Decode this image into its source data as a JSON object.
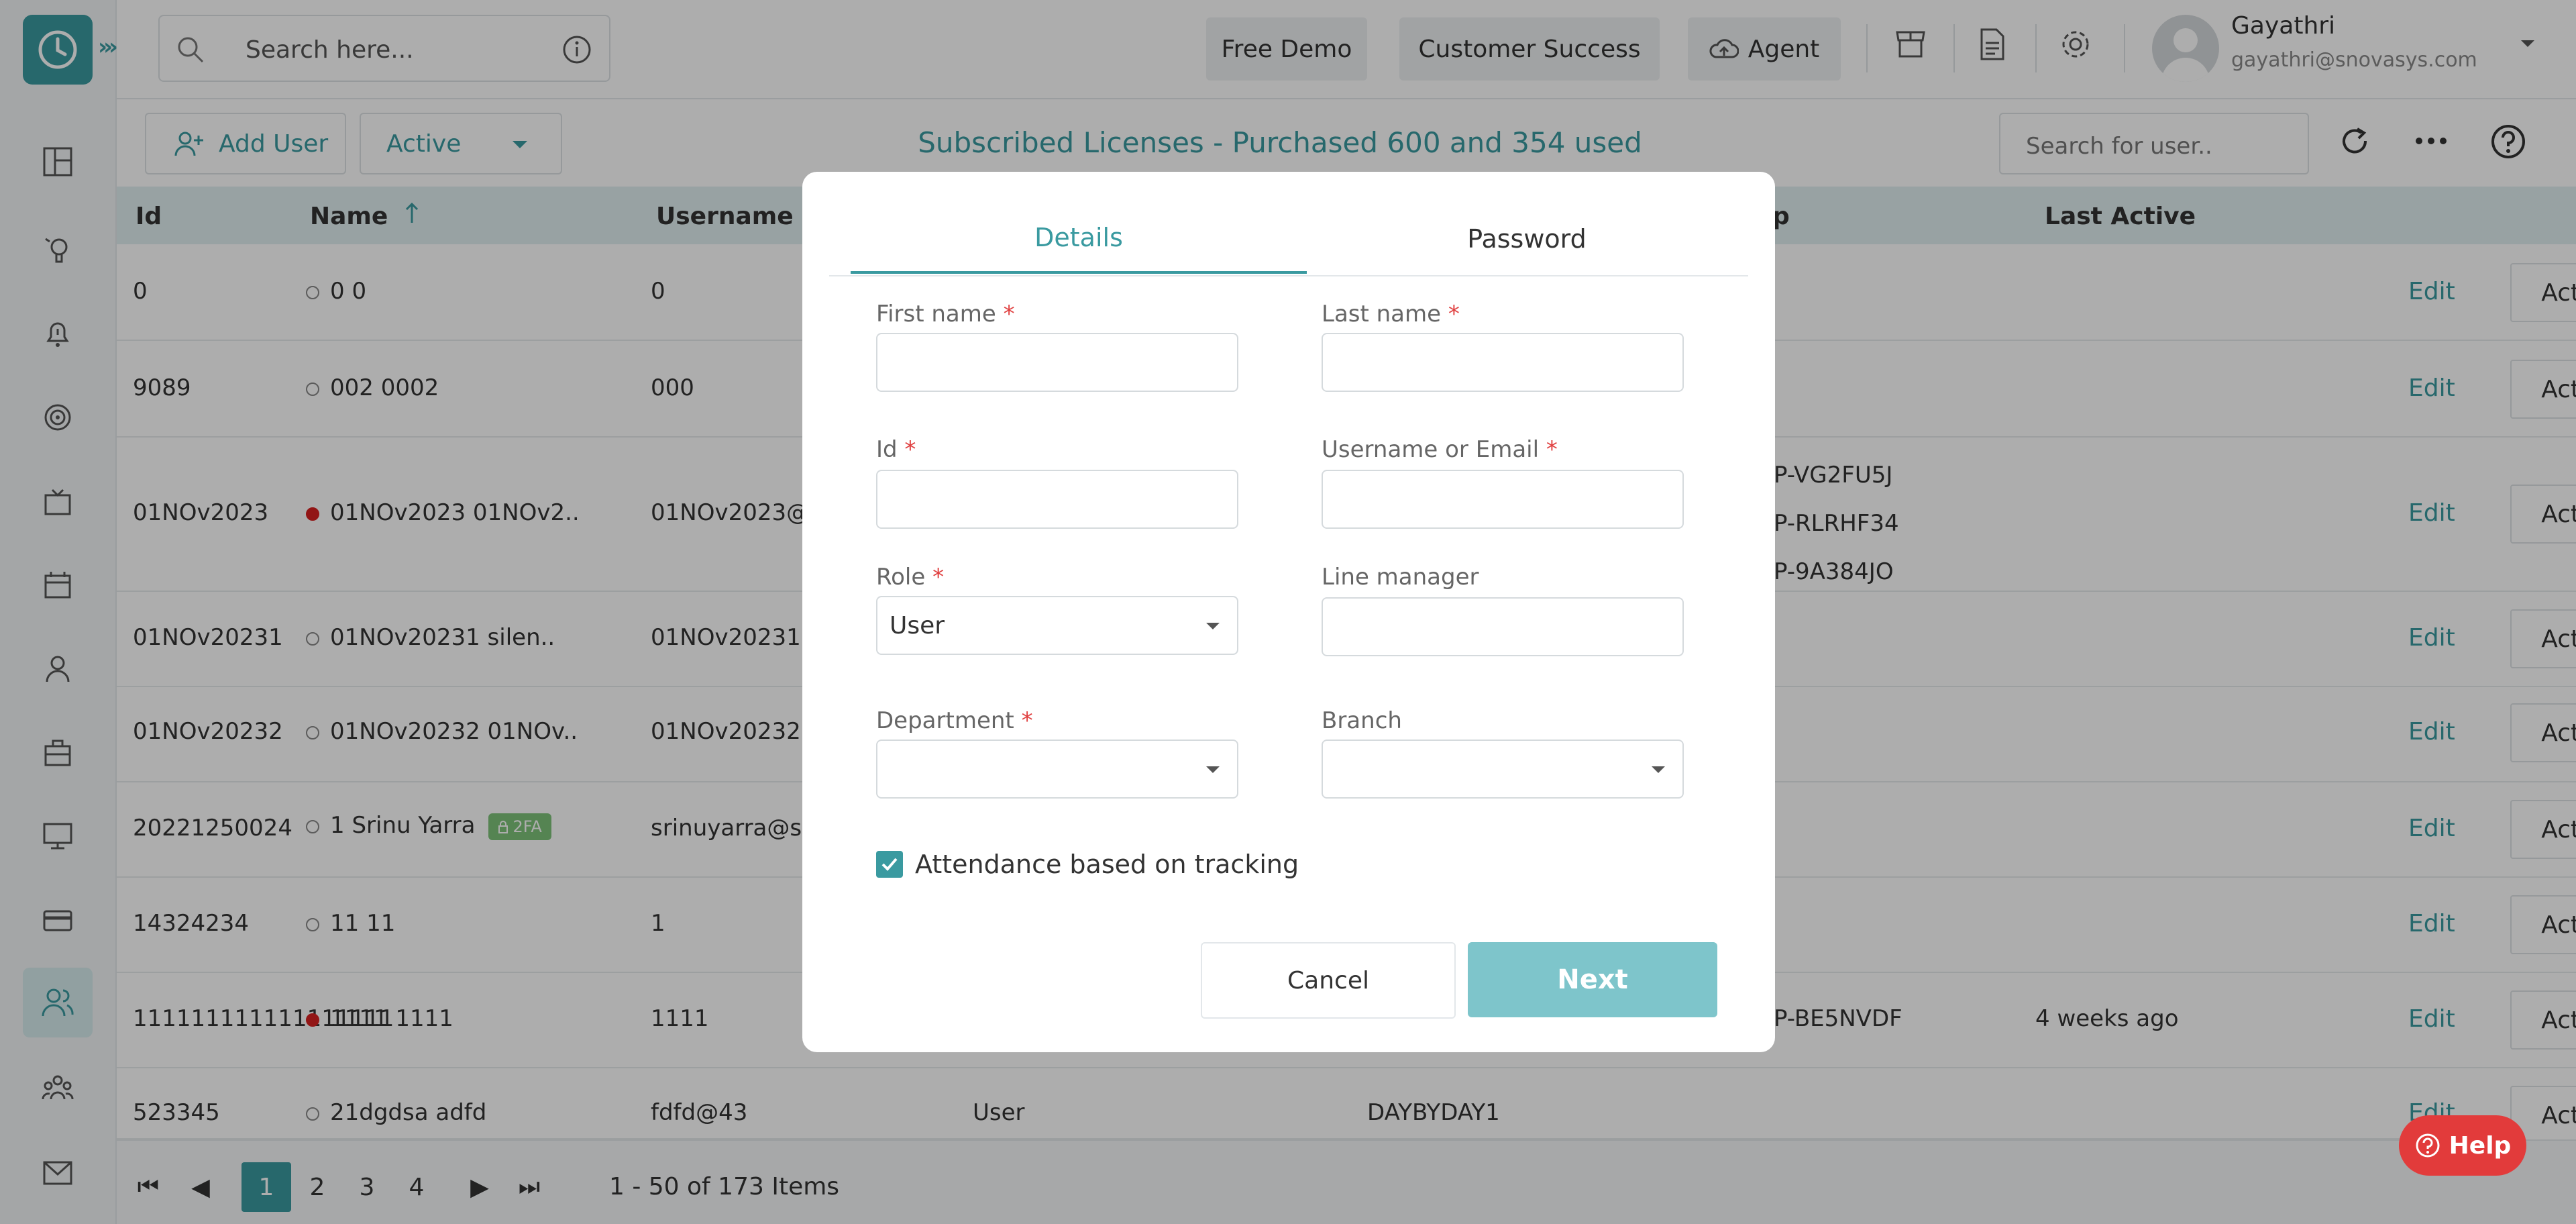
{
  "topbar": {
    "search_placeholder": "Search here...",
    "buttons": [
      "Free Demo",
      "Customer Success",
      "Agent"
    ],
    "user": {
      "name": "Gayathri",
      "email": "gayathri@snovasys.com"
    }
  },
  "sidebar": {
    "icons": [
      "dashboard-icon",
      "activity-icon",
      "alert-icon",
      "target-icon",
      "tv-icon",
      "calendar-icon",
      "user-icon",
      "briefcase-icon",
      "monitor-icon",
      "card-icon",
      "users-icon",
      "team-icon",
      "mail-icon"
    ],
    "active_index": 10
  },
  "toolbar": {
    "add_user": "Add User",
    "status": "Active",
    "licenses": "Subscribed Licenses - Purchased 600 and 354 used",
    "search_placeholder": "Search for user.."
  },
  "table": {
    "headers": {
      "id": "Id",
      "name": "Name",
      "username": "Username",
      "group": "p",
      "last_active": "Last Active"
    },
    "edit_label": "Edit",
    "actions_label": "Actions",
    "rows": [
      {
        "id": "0",
        "name": "0 0",
        "username": "0",
        "group": "",
        "last_active": "",
        "dot": "empty"
      },
      {
        "id": "9089",
        "name": "002 0002",
        "username": "000",
        "group": "",
        "last_active": "",
        "dot": "empty"
      },
      {
        "id": "01NOv2023",
        "name": "01NOv2023 01NOv2..",
        "username": "01NOv2023@",
        "group": "P-VG2FU5J|P-RLRHF34|P-9A384JO",
        "last_active": "",
        "dot": "red"
      },
      {
        "id": "01NOv20231",
        "name": "01NOv20231 silen..",
        "username": "01NOv20231@",
        "group": "",
        "last_active": "",
        "dot": "empty"
      },
      {
        "id": "01NOv20232",
        "name": "01NOv20232 01NOv..",
        "username": "01NOv20232@",
        "group": "",
        "last_active": "",
        "dot": "empty"
      },
      {
        "id": "20221250024",
        "name": "1 Srinu Yarra",
        "username": "srinuyarra@s",
        "group": "",
        "last_active": "",
        "dot": "empty",
        "badge": "2FA"
      },
      {
        "id": "14324234",
        "name": "11 11",
        "username": "1",
        "group": "",
        "last_active": "",
        "dot": "empty"
      },
      {
        "id": "111111111111111111",
        "name": "1111 1111",
        "username": "1111",
        "group": "P-BE5NVDF",
        "last_active": "4 weeks ago",
        "dot": "red"
      },
      {
        "id": "523345",
        "name": "21dgdsa adfd",
        "username": "fdfd@43",
        "role": "User",
        "group": "DAYBYDAY1",
        "last_active": "",
        "dot": "empty"
      }
    ]
  },
  "pager": {
    "pages": [
      "1",
      "2",
      "3",
      "4"
    ],
    "current": "1",
    "summary": "1 - 50 of 173 Items"
  },
  "help": "Help",
  "modal": {
    "tabs": [
      "Details",
      "Password"
    ],
    "active_tab": "Details",
    "fields": {
      "first_name": {
        "label": "First name",
        "value": ""
      },
      "last_name": {
        "label": "Last name",
        "value": ""
      },
      "id": {
        "label": "Id",
        "value": ""
      },
      "username": {
        "label": "Username or Email",
        "value": ""
      },
      "role": {
        "label": "Role",
        "value": "User"
      },
      "line_manager": {
        "label": "Line manager",
        "value": ""
      },
      "department": {
        "label": "Department",
        "value": ""
      },
      "branch": {
        "label": "Branch",
        "value": ""
      }
    },
    "required_mark": "*",
    "checkbox": {
      "label": "Attendance based on tracking",
      "checked": true
    },
    "cancel": "Cancel",
    "next": "Next"
  },
  "colors": {
    "accent": "#3a9aa0",
    "next": "#7ec5cb",
    "danger": "#e23b3b"
  }
}
